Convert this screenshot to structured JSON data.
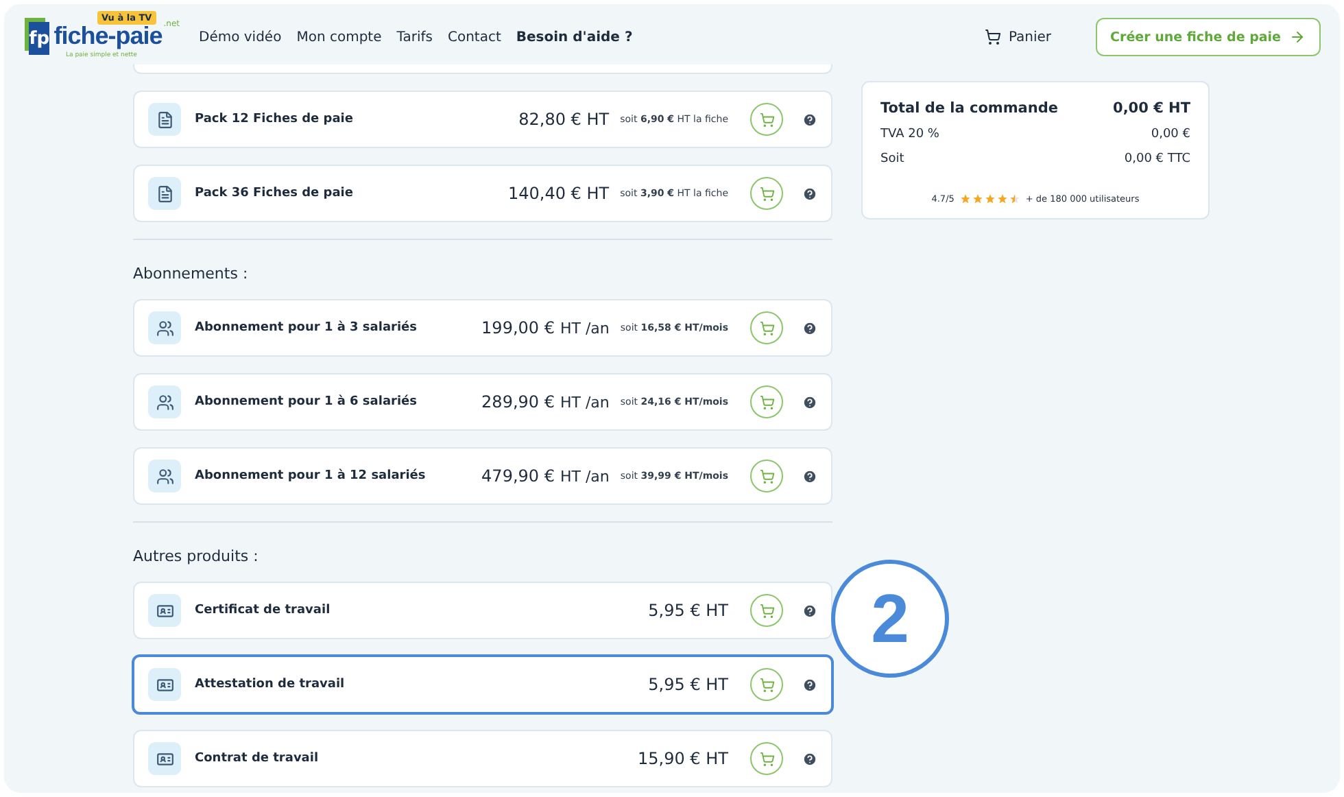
{
  "header": {
    "logo": {
      "badge": "Vu à la TV",
      "mark": "fp",
      "name": "fiche-paie",
      "suffix": ".net",
      "tagline": "La paie simple et nette"
    },
    "nav": [
      {
        "label": "Démo vidéo",
        "bold": false
      },
      {
        "label": "Mon compte",
        "bold": false
      },
      {
        "label": "Tarifs",
        "bold": false
      },
      {
        "label": "Contact",
        "bold": false
      },
      {
        "label": "Besoin d'aide ?",
        "bold": true
      }
    ],
    "cart": "Panier",
    "cta": "Créer une fiche de paie"
  },
  "sections": [
    {
      "items": [
        {
          "kind": "pack",
          "name": "Pack 12 Fiches de paie",
          "price": "82,80 € HT",
          "note": "soit **6,90 €** HT la fiche",
          "highlighted": false
        },
        {
          "kind": "pack",
          "name": "Pack 36 Fiches de paie",
          "price": "140,40 € HT",
          "note": "soit **3,90 €** HT la fiche",
          "highlighted": false
        }
      ]
    },
    {
      "title": "Abonnements :",
      "items": [
        {
          "kind": "subscription",
          "name": "Abonnement pour 1 à 3 salariés",
          "price": "199,00 €",
          "unit": "HT /an",
          "note": "soit **16,58 € HT/mois**",
          "highlighted": false
        },
        {
          "kind": "subscription",
          "name": "Abonnement pour 1 à 6 salariés",
          "price": "289,90 €",
          "unit": "HT /an",
          "note": "soit **24,16 € HT/mois**",
          "highlighted": false
        },
        {
          "kind": "subscription",
          "name": "Abonnement pour 1 à 12 salariés",
          "price": "479,90 €",
          "unit": "HT /an",
          "note": "soit **39,99 € HT/mois**",
          "highlighted": false
        }
      ]
    },
    {
      "title": "Autres produits :",
      "items": [
        {
          "kind": "document",
          "name": "Certificat de travail",
          "price": "5,95 € HT",
          "highlighted": false
        },
        {
          "kind": "document",
          "name": "Attestation de travail",
          "price": "5,95 € HT",
          "highlighted": true
        },
        {
          "kind": "document",
          "name": "Contrat de travail",
          "price": "15,90 € HT",
          "highlighted": false
        }
      ]
    }
  ],
  "summary": {
    "title": "Total de la commande",
    "total": "0,00 € HT",
    "rows": [
      {
        "label": "TVA 20 %",
        "value": "0,00 €"
      },
      {
        "label": "Soit",
        "value": "0,00 € TTC"
      }
    ],
    "rating": "4.7/5",
    "stars": 4.5,
    "users": "+ de 180 000 utilisateurs"
  },
  "annotation": "2"
}
